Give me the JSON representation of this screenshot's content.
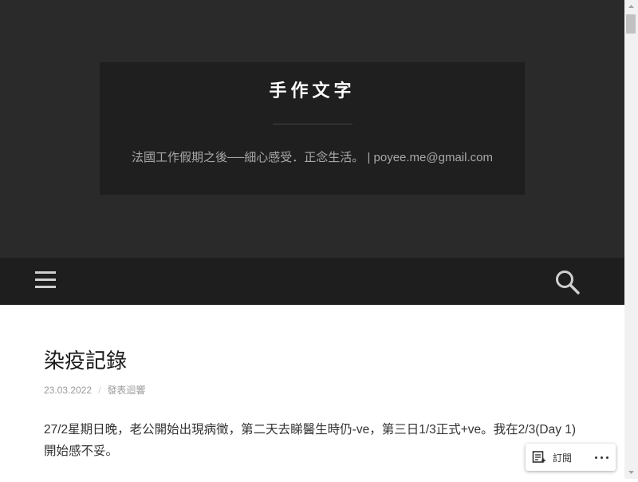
{
  "site": {
    "title": "手作文字",
    "tagline": "法國工作假期之後──細心感受．正念生活。 | poyee.me@gmail.com"
  },
  "nav": {
    "menu_icon": "hamburger-menu-icon",
    "search_icon": "search-icon"
  },
  "post": {
    "title": "染疫記錄",
    "date": "23.03.2022",
    "separator": "/",
    "comment_link": "發表迴響",
    "body": "27/2星期日晚，老公開始出現病徵，第二天去睇醫生時仍-ve，第三日1/3正式+ve。我在2/3(Day 1)開始感不妥。"
  },
  "follow_bar": {
    "follow_label": "訂閱",
    "follow_icon": "reader-follow-icon",
    "more_icon": "more-horizontal-icon"
  },
  "colors": {
    "hero_bg": "#2a2a2a",
    "title_box_bg": "#1f1f1f",
    "navbar_bg": "#1e1e1e",
    "title_text": "#ffffff",
    "tagline_text": "#a8a8a8"
  }
}
